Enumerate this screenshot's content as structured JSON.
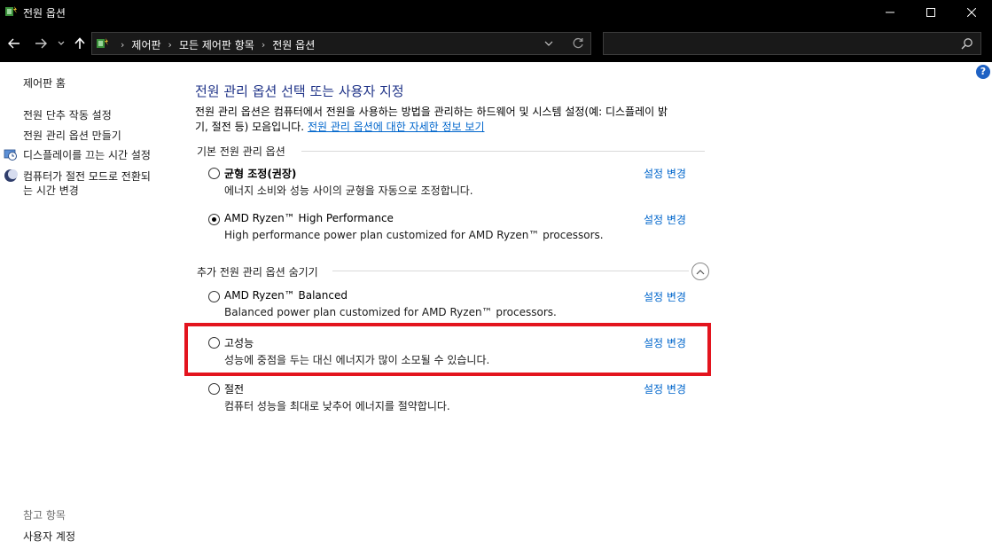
{
  "window": {
    "title": "전원 옵션"
  },
  "navigation": {
    "breadcrumbs": [
      "제어판",
      "모든 제어판 항목",
      "전원 옵션"
    ],
    "search_placeholder": ""
  },
  "sidebar": {
    "links": [
      {
        "label": "제어판 홈"
      },
      {
        "label": "전원 단추 작동 설정"
      },
      {
        "label": "전원 관리 옵션 만들기"
      },
      {
        "label": "디스플레이를 끄는 시간 설정",
        "icon": "display-clock-icon"
      },
      {
        "label": "컴퓨터가 절전 모드로 전환되",
        "label2": "는 시간 변경",
        "icon": "moon-icon"
      }
    ],
    "see_also_title": "참고 항목",
    "see_also_links": [
      "사용자 계정"
    ]
  },
  "main": {
    "title": "전원 관리 옵션 선택 또는 사용자 지정",
    "description_line1": "전원 관리 옵션은 컴퓨터에서 전원을 사용하는 방법을 관리하는 하드웨어 및 시스템 설정(예: 디스플레이 밝",
    "description_line2": "기, 절전 등) 모음입니다.",
    "description_link": "전원 관리 옵션에 대한 자세한 정보 보기",
    "preferred_header": "기본 전원 관리 옵션",
    "hidden_header": "추가 전원 관리 옵션 숨기기",
    "change_settings_label": "설정 변경",
    "plans": [
      {
        "name": "균형 조정(권장)",
        "description": "에너지 소비와 성능 사이의 균형을 자동으로 조정합니다.",
        "selected": false,
        "bold": true
      },
      {
        "name": "AMD Ryzen™ High Performance",
        "description": "High performance power plan customized for AMD Ryzen™ processors.",
        "selected": true
      },
      {
        "name": "AMD Ryzen™ Balanced",
        "description": "Balanced power plan customized for AMD Ryzen™ processors.",
        "selected": false
      },
      {
        "name": "고성능",
        "description": "성능에 중점을 두는 대신 에너지가 많이 소모될 수 있습니다.",
        "selected": false
      },
      {
        "name": "절전",
        "description": "컴퓨터 성능을 최대로 낮추어 에너지를 절약합니다.",
        "selected": false
      }
    ]
  },
  "colors": {
    "title_blue": "#1e3287",
    "link_blue": "#0066cc",
    "highlight_red": "#e3141e"
  }
}
